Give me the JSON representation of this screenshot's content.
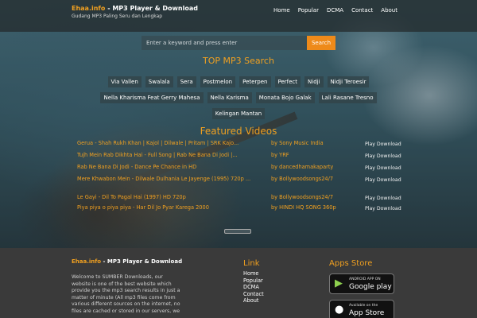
{
  "header": {
    "brand_name": "Ehaa.info",
    "brand_suffix": " - MP3 Player & Download",
    "tagline": "Gudang MP3 Paling Seru dan Lengkap",
    "nav": [
      "Home",
      "Popular",
      "DCMA",
      "Contact",
      "About"
    ]
  },
  "search": {
    "placeholder": "Enter a keyword and press enter",
    "button_label": "Search"
  },
  "top_search": {
    "title": "TOP MP3 Search",
    "tags": [
      "Via Vallen",
      "Swalala",
      "Sera",
      "Postmelon",
      "Peterpen",
      "Perfect",
      "Nidji",
      "Nidji Teroesir",
      "Nella Kharisma Feat Gerry Mahesa",
      "Nella Karisma",
      "Monata Bojo Galak",
      "Lali Rasane Tresno",
      "Kelingan Mantan"
    ]
  },
  "featured": {
    "title": "Featured Videos",
    "videos": [
      {
        "title": "Gerua - Shah Rukh Khan | Kajol | Dilwale | Pritam | SRK Kajo...",
        "by": "by Sony Music India",
        "play": "Play Download"
      },
      {
        "title": "Tujh Mein Rab Dikhta Hai - Full Song | Rab Ne Bana Di Jodi |...",
        "by": "by YRF",
        "play": "Play Download"
      },
      {
        "title": "Rab Ne Bana Di Jodi - Dance Pe Chance in HD",
        "by": "by dancedhamakaparty",
        "play": "Play Download"
      },
      {
        "title": "Mere Khwabon Mein - Dilwale Dulhania Le Jayenge (1995) 720p ...",
        "by": "by Bollywoodsongs24/7",
        "play": "Play Download"
      },
      {
        "title": "Le Gayi - Dil To Pagal Hai (1997) HD 720p",
        "by": "by Bollywoodsongs24/7",
        "play": "Play Download"
      },
      {
        "title": "Piya piya o piya piya - Har Dil Jo Pyar Karega 2000",
        "by": "by HINDI HQ SONG 360p",
        "play": "Play Download"
      }
    ]
  },
  "footer": {
    "brand_name": "Ehaa.info",
    "brand_suffix": " - MP3 Player & Download",
    "about": "Welcome to SUMBER Downloads, our website is one of the best website which provide you the mp3 search results in just a matter of minute (All mp3 files come from various different sources on the internet, no files are cached or stored in our servers, we",
    "links_title": "Link",
    "links": [
      "Home",
      "Popular",
      "DCMA",
      "Contact",
      "About"
    ],
    "apps_title": "Apps Store",
    "google": {
      "small": "ANDROID APP ON",
      "big": "Google play"
    },
    "apple": {
      "small": "Available on the",
      "big": "App Store"
    }
  },
  "colors": {
    "accent": "#f0a020",
    "search_button": "#ee8a1a",
    "footer_bg": "#3a3a3a"
  }
}
